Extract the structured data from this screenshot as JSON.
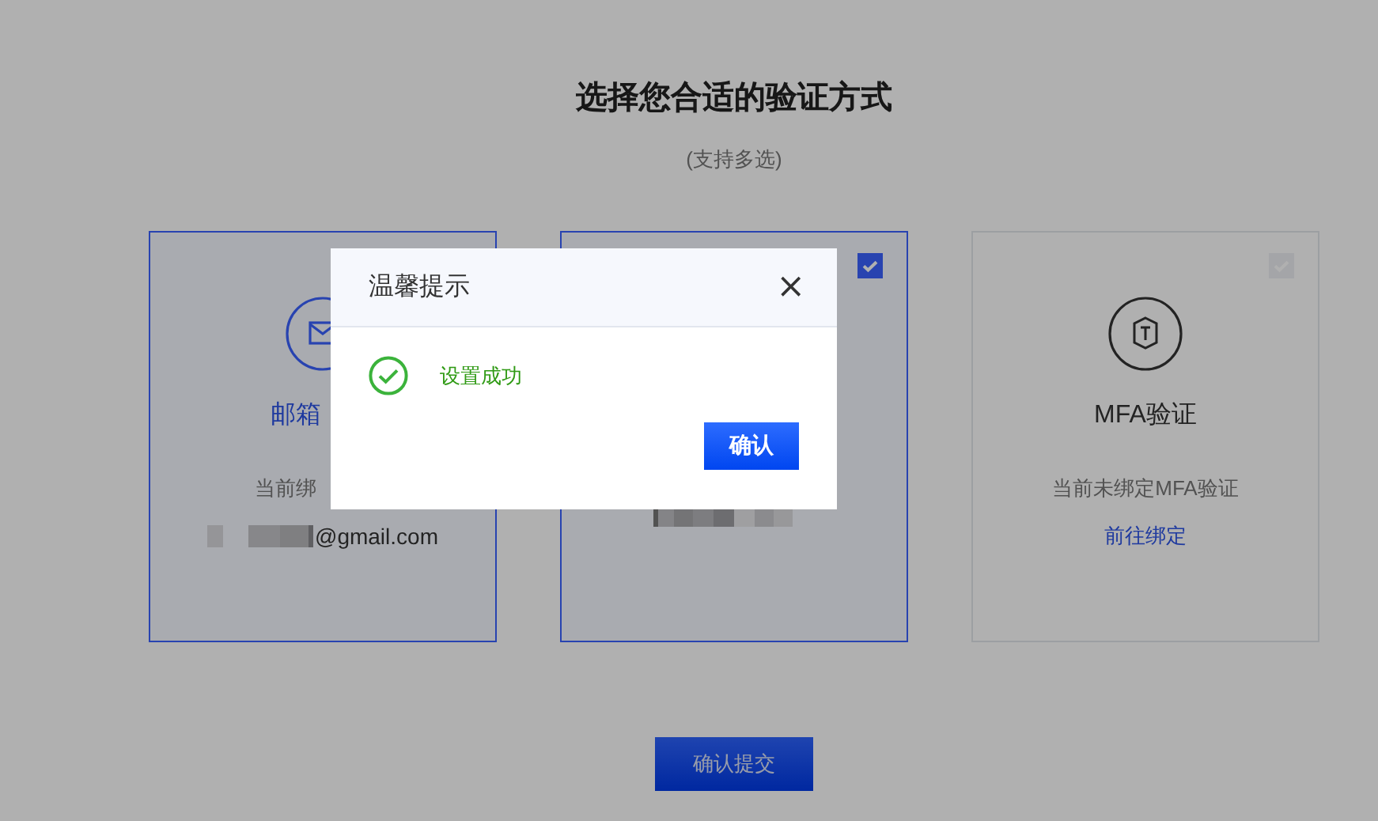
{
  "heading": "选择您合适的验证方式",
  "subheading": "(支持多选)",
  "cards": [
    {
      "kind": "email",
      "selected": true,
      "title": "邮箱",
      "subtitle": "当前绑",
      "value": {
        "kind": "email",
        "text": "@gmail.com"
      }
    },
    {
      "kind": "masked",
      "selected": true,
      "checkbox": {
        "checked": true
      },
      "value": {
        "kind": "redacted"
      }
    },
    {
      "kind": "mfa",
      "selected": false,
      "checkbox": {
        "checked": false
      },
      "title": "MFA验证",
      "subtitle": "当前未绑定MFA验证",
      "value": {
        "kind": "link",
        "text": "前往绑定"
      }
    }
  ],
  "submit_button": "确认提交",
  "dialog": {
    "title": "温馨提示",
    "close": "×",
    "kind": "success",
    "message": "设置成功",
    "confirm_button": "确认"
  }
}
